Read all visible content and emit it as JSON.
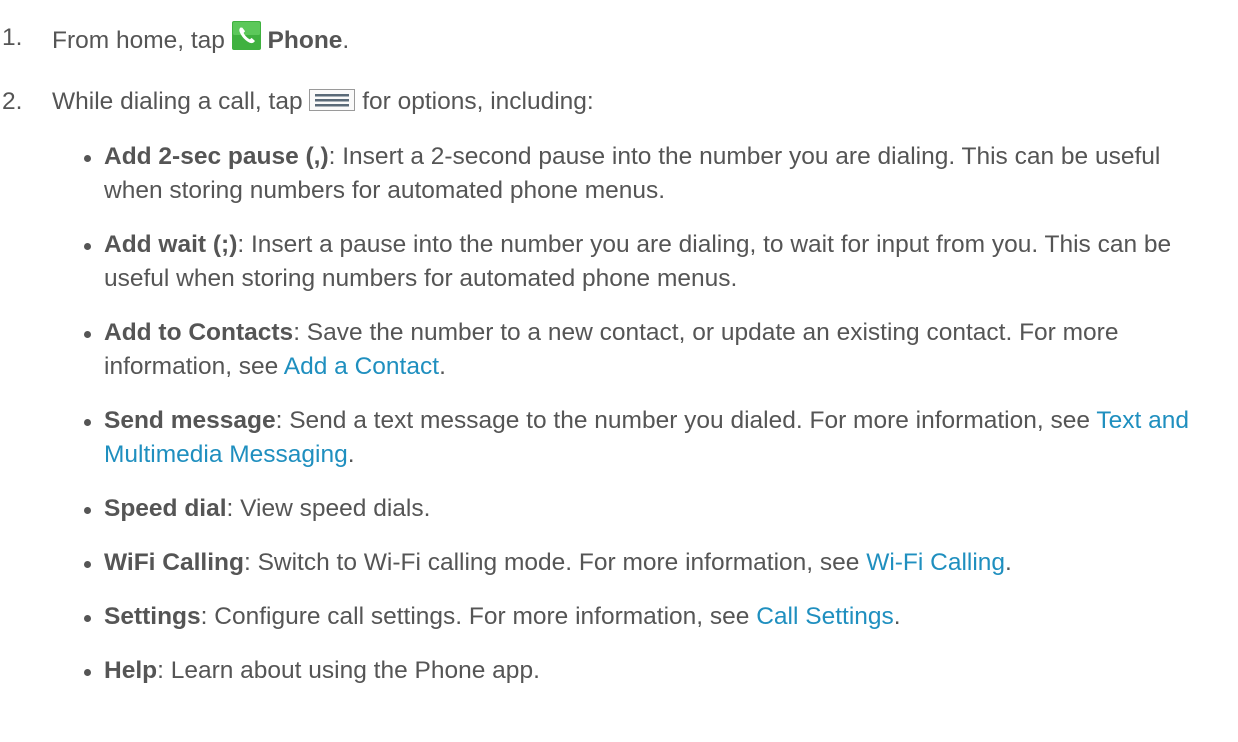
{
  "step1": {
    "number": "1.",
    "prefix": "From home, tap ",
    "app_name": "Phone",
    "suffix": "."
  },
  "step2": {
    "number": "2.",
    "prefix": "While dialing a call, tap ",
    "suffix": " for options, including:"
  },
  "options": [
    {
      "term": "Add 2-sec pause (,)",
      "text": ": Insert a 2-second pause into the number you are dialing. This can be useful when storing numbers for automated phone menus."
    },
    {
      "term": "Add wait (;)",
      "text": ": Insert a pause into the number you are dialing, to wait for input from you. This can be useful when storing numbers for automated phone menus."
    },
    {
      "term": "Add to Contacts",
      "text": ": Save the number to a new contact, or update an existing contact. For more information, see ",
      "link": "Add a Contact",
      "after": "."
    },
    {
      "term": "Send message",
      "text": ": Send a text message to the number you dialed. For more information, see ",
      "link": "Text and Multimedia Messaging",
      "after": "."
    },
    {
      "term": "Speed dial",
      "text": ": View speed dials."
    },
    {
      "term": "WiFi Calling",
      "text": ": Switch to Wi-Fi calling mode. For more information, see ",
      "link": "Wi-Fi Calling",
      "after": "."
    },
    {
      "term": "Settings",
      "text": ": Configure call settings. For more information, see ",
      "link": "Call Settings",
      "after": "."
    },
    {
      "term": "Help",
      "text": ": Learn about using the Phone app."
    }
  ],
  "icons": {
    "phone": "phone-app-icon",
    "menu": "menu-icon"
  },
  "colors": {
    "text": "#555555",
    "link": "#1f8fbf",
    "phone_icon_green": "#3fb13f"
  }
}
